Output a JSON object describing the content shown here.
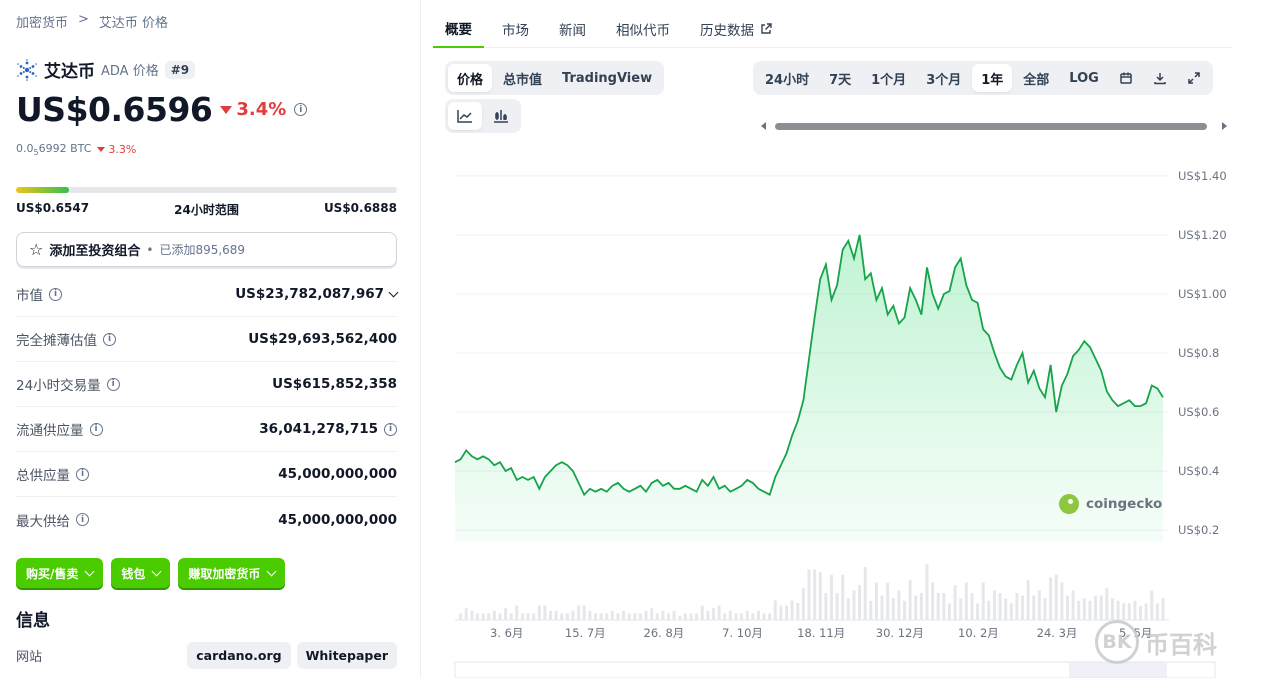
{
  "breadcrumb": {
    "root": "加密货币",
    "sep": ">",
    "current": "艾达币 价格"
  },
  "coin": {
    "name": "艾达币",
    "symbol": "ADA 价格",
    "rank": "#9"
  },
  "price": {
    "usd": "US$0.6596",
    "change": "3.4%",
    "btc_prefix": "0.0",
    "btc_sub": "5",
    "btc_rest": "6992 BTC",
    "btc_change": "3.3%"
  },
  "range": {
    "low": "US$0.6547",
    "label": "24小时范围",
    "high": "US$0.6888",
    "fill_fraction": 0.14
  },
  "portfolio": {
    "label": "添加至投资组合",
    "bullet": "•",
    "sub": "已添加895,689"
  },
  "stats": [
    {
      "label": "市值",
      "value": "US$23,782,087,967"
    },
    {
      "label": "完全摊薄估值",
      "value": "US$29,693,562,400"
    },
    {
      "label": "24小时交易量",
      "value": "US$615,852,358"
    },
    {
      "label": "流通供应量",
      "value": "36,041,278,715"
    },
    {
      "label": "总供应量",
      "value": "45,000,000,000"
    },
    {
      "label": "最大供给",
      "value": "45,000,000,000"
    }
  ],
  "actions": {
    "buy": "购买/售卖",
    "wallet": "钱包",
    "earn": "赚取加密货币"
  },
  "info": {
    "title": "信息",
    "website_label": "网站",
    "links": [
      "cardano.org",
      "Whitepaper"
    ]
  },
  "tabs": [
    "概要",
    "市场",
    "新闻",
    "相似代币",
    "历史数据"
  ],
  "chart_types": [
    "价格",
    "总市值",
    "TradingView"
  ],
  "ranges": [
    "24小时",
    "7天",
    "1个月",
    "3个月",
    "1年",
    "全部",
    "LOG"
  ],
  "watermark": "币百科",
  "brand": "coingecko",
  "colors": {
    "accent": "#4bcc00",
    "down": "#e03e3e",
    "line": "#16a34a"
  },
  "chart_data": {
    "type": "area",
    "ylabel": "",
    "y_ticks": [
      "US$0.2",
      "US$0.4",
      "US$0.6",
      "US$0.8",
      "US$1.00",
      "US$1.20",
      "US$1.40"
    ],
    "y_tick_values": [
      0.2,
      0.4,
      0.6,
      0.8,
      1.0,
      1.2,
      1.4
    ],
    "ylim": [
      0.18,
      1.42
    ],
    "x_ticks": [
      "3. 6月",
      "15. 7月",
      "26. 8月",
      "7. 10月",
      "18. 11月",
      "30. 12月",
      "10. 2月",
      "24. 3月",
      "5. 5月"
    ],
    "x_tick_positions": [
      0.071,
      0.179,
      0.287,
      0.395,
      0.503,
      0.611,
      0.719,
      0.827,
      0.935
    ],
    "series": [
      {
        "values": [
          0.43,
          0.44,
          0.47,
          0.45,
          0.44,
          0.45,
          0.44,
          0.42,
          0.43,
          0.4,
          0.41,
          0.37,
          0.38,
          0.37,
          0.38,
          0.34,
          0.38,
          0.4,
          0.42,
          0.43,
          0.42,
          0.4,
          0.36,
          0.32,
          0.34,
          0.33,
          0.34,
          0.33,
          0.35,
          0.36,
          0.34,
          0.33,
          0.34,
          0.35,
          0.33,
          0.36,
          0.37,
          0.35,
          0.36,
          0.34,
          0.34,
          0.35,
          0.34,
          0.33,
          0.37,
          0.35,
          0.38,
          0.34,
          0.35,
          0.33,
          0.34,
          0.35,
          0.37,
          0.36,
          0.34,
          0.33,
          0.32,
          0.38,
          0.42,
          0.46,
          0.52,
          0.57,
          0.64,
          0.78,
          0.92,
          1.05,
          1.1,
          0.98,
          1.03,
          1.15,
          1.18,
          1.12,
          1.2,
          1.05,
          1.07,
          0.98,
          1.02,
          0.93,
          0.96,
          0.9,
          0.92,
          1.02,
          0.98,
          0.93,
          1.09,
          1.0,
          0.95,
          1.0,
          1.01,
          1.09,
          1.12,
          1.03,
          0.98,
          0.97,
          0.88,
          0.86,
          0.8,
          0.75,
          0.72,
          0.71,
          0.76,
          0.8,
          0.7,
          0.74,
          0.68,
          0.65,
          0.76,
          0.6,
          0.69,
          0.73,
          0.79,
          0.81,
          0.84,
          0.82,
          0.78,
          0.74,
          0.67,
          0.64,
          0.62,
          0.63,
          0.64,
          0.62,
          0.62,
          0.63,
          0.69,
          0.68,
          0.65
        ]
      }
    ]
  }
}
